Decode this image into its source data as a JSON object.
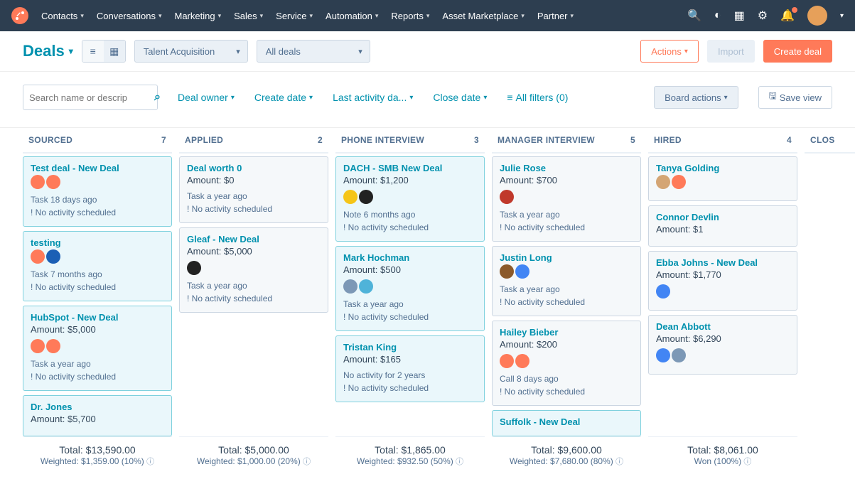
{
  "nav": {
    "items": [
      "Contacts",
      "Conversations",
      "Marketing",
      "Sales",
      "Service",
      "Automation",
      "Reports",
      "Asset Marketplace",
      "Partner"
    ]
  },
  "page": {
    "title": "Deals",
    "pipeline": "Talent Acquisition",
    "scope": "All deals",
    "actions_label": "Actions",
    "import_label": "Import",
    "create_label": "Create deal"
  },
  "filters": {
    "search_placeholder": "Search name or descrip",
    "links": [
      "Deal owner",
      "Create date",
      "Last activity da...",
      "Close date"
    ],
    "all_filters": "All filters (0)",
    "board_actions": "Board actions",
    "save_view": "Save view"
  },
  "columns": [
    {
      "name": "Sourced",
      "count": 7,
      "cards": [
        {
          "title": "Test deal - New Deal",
          "amount": "",
          "highlight": true,
          "icons": [
            "#ff7a59",
            "#ff7a59"
          ],
          "line1": "Task 18 days ago",
          "line2": "No activity scheduled"
        },
        {
          "title": "testing",
          "amount": "",
          "highlight": true,
          "icons": [
            "#ff7a59",
            "#1b5fb5"
          ],
          "line1": "Task 7 months ago",
          "line2": "No activity scheduled"
        },
        {
          "title": "HubSpot - New Deal",
          "amount": "Amount: $5,000",
          "highlight": true,
          "icons": [
            "#ff7a59",
            "#ff7a59"
          ],
          "line1": "Task a year ago",
          "line2": "No activity scheduled"
        },
        {
          "title": "Dr. Jones",
          "amount": "Amount: $5,700",
          "highlight": true,
          "icons": [],
          "line1": "",
          "line2": ""
        }
      ],
      "total": "Total: $13,590.00",
      "weighted": "Weighted: $1,359.00 (10%)"
    },
    {
      "name": "Applied",
      "count": 2,
      "cards": [
        {
          "title": "Deal worth 0",
          "amount": "Amount: $0",
          "highlight": false,
          "icons": [],
          "line1": "Task a year ago",
          "line2": "No activity scheduled"
        },
        {
          "title": "Gleaf - New Deal",
          "amount": "Amount: $5,000",
          "highlight": false,
          "icons": [
            "#222"
          ],
          "line1": "Task a year ago",
          "line2": "No activity scheduled"
        }
      ],
      "total": "Total: $5,000.00",
      "weighted": "Weighted: $1,000.00 (20%)"
    },
    {
      "name": "Phone Interview",
      "count": 3,
      "cards": [
        {
          "title": "DACH - SMB New Deal",
          "amount": "Amount: $1,200",
          "highlight": true,
          "icons": [
            "#f5c518",
            "#222"
          ],
          "line1": "Note 6 months ago",
          "line2": "No activity scheduled"
        },
        {
          "title": "Mark Hochman",
          "amount": "Amount: $500",
          "highlight": true,
          "icons": [
            "#7c98b6",
            "#4fb3d9"
          ],
          "line1": "Task a year ago",
          "line2": "No activity scheduled"
        },
        {
          "title": "Tristan King",
          "amount": "Amount: $165",
          "highlight": true,
          "icons": [],
          "line1": "No activity for 2 years",
          "line2": "No activity scheduled"
        }
      ],
      "total": "Total: $1,865.00",
      "weighted": "Weighted: $932.50 (50%)"
    },
    {
      "name": "Manager Interview",
      "count": 5,
      "cards": [
        {
          "title": "Julie Rose",
          "amount": "Amount: $700",
          "highlight": false,
          "icons": [
            "#c0392b"
          ],
          "line1": "Task a year ago",
          "line2": "No activity scheduled"
        },
        {
          "title": "Justin Long",
          "amount": "",
          "highlight": false,
          "icons": [
            "#8b5a2b",
            "#4285f4"
          ],
          "line1": "Task a year ago",
          "line2": "No activity scheduled"
        },
        {
          "title": "Hailey Bieber",
          "amount": "Amount: $200",
          "highlight": false,
          "icons": [
            "#ff7a59",
            "#ff7a59"
          ],
          "line1": "Call 8 days ago",
          "line2": "No activity scheduled"
        },
        {
          "title": "Suffolk - New Deal",
          "amount": "",
          "highlight": true,
          "icons": [],
          "line1": "",
          "line2": ""
        }
      ],
      "total": "Total: $9,600.00",
      "weighted": "Weighted: $7,680.00 (80%)"
    },
    {
      "name": "Hired",
      "count": 4,
      "cards": [
        {
          "title": "Tanya Golding",
          "amount": "",
          "highlight": false,
          "icons": [
            "#d4a574",
            "#ff7a59"
          ],
          "line1": "",
          "line2": ""
        },
        {
          "title": "Connor Devlin",
          "amount": "Amount: $1",
          "highlight": false,
          "icons": [],
          "line1": "",
          "line2": ""
        },
        {
          "title": "Ebba Johns - New Deal",
          "amount": "Amount: $1,770",
          "highlight": false,
          "icons": [
            "#4285f4"
          ],
          "line1": "",
          "line2": ""
        },
        {
          "title": "Dean Abbott",
          "amount": "Amount: $6,290",
          "highlight": false,
          "icons": [
            "#4285f4",
            "#7c98b6"
          ],
          "line1": "",
          "line2": ""
        }
      ],
      "total": "Total: $8,061.00",
      "weighted": "Won (100%)"
    },
    {
      "name": "Clos",
      "count": "",
      "cards": [],
      "total": "",
      "weighted": ""
    }
  ]
}
